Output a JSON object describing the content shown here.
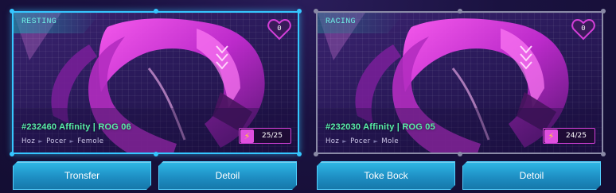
{
  "cards": [
    {
      "status": "RESTING",
      "likes": "0",
      "name": "#232460 Affinity | ROG 06",
      "traits": [
        "Hoz",
        "Pocer",
        "Femole"
      ],
      "energy": "25/25",
      "buttons": [
        "Tronsfer",
        "Detoil"
      ]
    },
    {
      "status": "RACING",
      "likes": "0",
      "name": "#232030 Affinity | ROG 05",
      "traits": [
        "Hoz",
        "Pocer",
        "Mole"
      ],
      "energy": "24/25",
      "buttons": [
        "Toke Bock",
        "Detoil"
      ]
    }
  ],
  "colors": {
    "accent": "#35c6ff",
    "racing_border": "#8a8aa6",
    "name_text": "#59f0a7",
    "energy_border": "#d43fd8",
    "heart": "#d43fd8",
    "button": "#1e8fc4"
  },
  "icons": {
    "heart": "heart-icon",
    "energy": "lightning-icon",
    "separator": "arrow-right-icon"
  }
}
